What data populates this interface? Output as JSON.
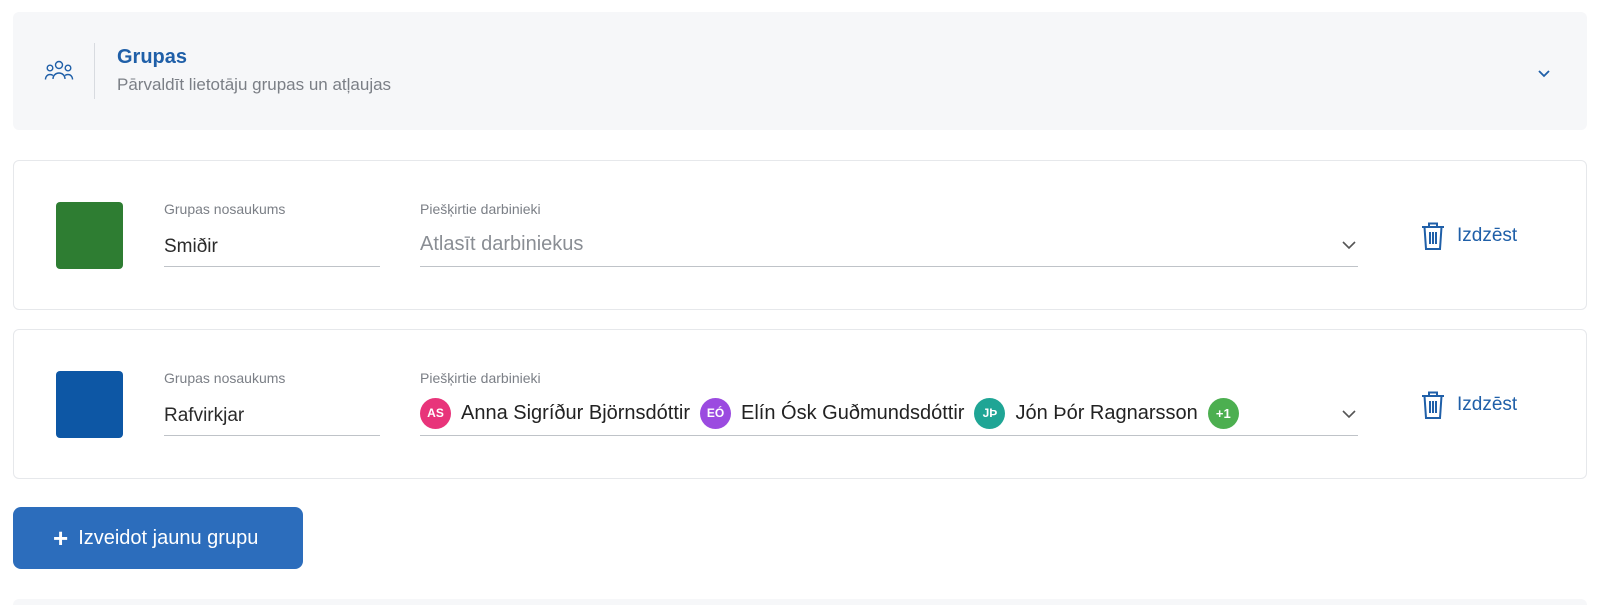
{
  "header": {
    "title": "Grupas",
    "subtitle": "Pārvaldīt lietotāju grupas un atļaujas",
    "icon": "users-icon"
  },
  "groups": [
    {
      "color": "#2e7d32",
      "name_label": "Grupas nosaukums",
      "name_value": "Smiðir",
      "employees_label": "Piešķirtie darbinieki",
      "employees_placeholder": "Atlasīt darbiniekus",
      "employees": [],
      "delete_label": "Izdzēst"
    },
    {
      "color": "#0d57a5",
      "name_label": "Grupas nosaukums",
      "name_value": "Rafvirkjar",
      "employees_label": "Piešķirtie darbinieki",
      "employees": [
        {
          "initials": "AS",
          "name": "Anna Sigríður Björnsdóttir",
          "color": "#e8347a"
        },
        {
          "initials": "EÓ",
          "name": "Elín Ósk Guðmundsdóttir",
          "color": "#9b4be0"
        },
        {
          "initials": "JÞ",
          "name": "Jón Þór Ragnarsson",
          "color": "#1fa595"
        }
      ],
      "more_count": "+1",
      "more_color": "#4caf50",
      "delete_label": "Izdzēst"
    }
  ],
  "create_button": {
    "plus": "+",
    "label": "Izveidot jaunu grupu"
  },
  "colors": {
    "accent": "#1f5fa8",
    "button": "#2c6dbc"
  }
}
